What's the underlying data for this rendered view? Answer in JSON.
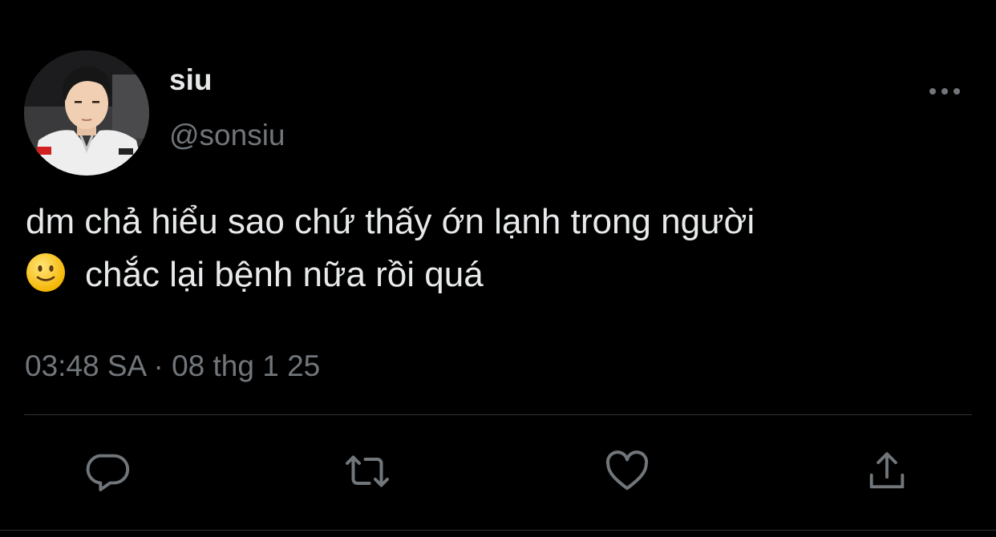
{
  "user": {
    "display_name": "siu",
    "handle": "@sonsiu"
  },
  "tweet": {
    "line1": "dm chả hiểu sao chứ thấy ớn lạnh trong người",
    "line2": "chắc lại bệnh nữa rồi quá",
    "emoji": "slightly-smiling-face-emoji"
  },
  "meta": {
    "time": "03:48 SA",
    "separator": "·",
    "date": "08 thg 1 25"
  },
  "icons": {
    "more": "more-icon",
    "reply": "reply-icon",
    "retweet": "retweet-icon",
    "like": "like-icon",
    "share": "share-icon"
  },
  "colors": {
    "background": "#000000",
    "primary_text": "#e7e9ea",
    "secondary_text": "#71767b",
    "divider": "#2f3336"
  }
}
